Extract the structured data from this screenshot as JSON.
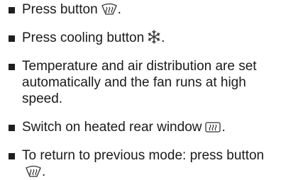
{
  "items": [
    {
      "text": "Press button",
      "suffix": ".",
      "icon": "windscreen-defrost-icon"
    },
    {
      "text": "Press cooling button",
      "suffix": ".",
      "icon": "snowflake-icon"
    },
    {
      "text": "Temperature and air distribution are set automatically and the fan runs at high speed."
    },
    {
      "text": "Switch on heated rear window",
      "suffix": ".",
      "icon": "rear-window-heating-icon"
    },
    {
      "text": "To return to previous mode: press button",
      "suffix": ".",
      "icon": "windscreen-defrost-icon"
    }
  ]
}
